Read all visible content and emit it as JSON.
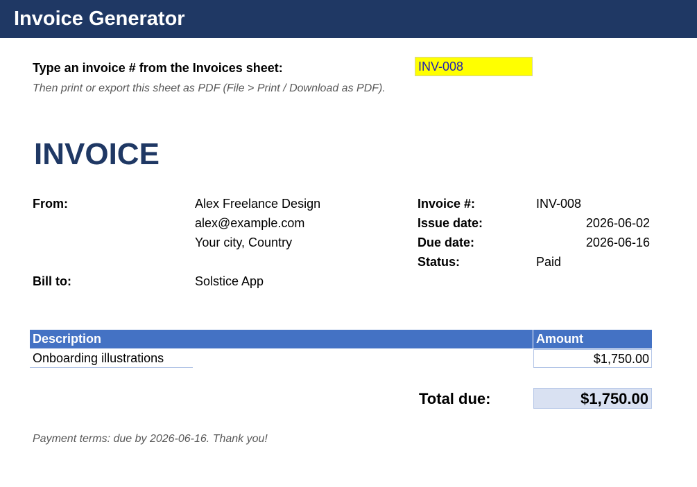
{
  "app": {
    "title": "Invoice Generator"
  },
  "colors": {
    "header_bg": "#1f3864",
    "input_highlight": "#ffff00",
    "table_header_bg": "#4472c4",
    "total_bg": "#d9e1f2"
  },
  "prompt": {
    "label": "Type an invoice # from the Invoices sheet:",
    "input_value": "INV-008",
    "hint": "Then print or export this sheet as PDF (File > Print / Download as PDF)."
  },
  "invoice": {
    "heading": "INVOICE",
    "from_label": "From:",
    "from_lines": [
      "Alex Freelance Design",
      "alex@example.com",
      "Your city, Country"
    ],
    "bill_to_label": "Bill to:",
    "bill_to": "Solstice App",
    "meta": {
      "number_label": "Invoice #:",
      "number": "INV-008",
      "issue_label": "Issue date:",
      "issue_date": "2026-06-02",
      "due_label": "Due date:",
      "due_date": "2026-06-16",
      "status_label": "Status:",
      "status": "Paid"
    }
  },
  "table": {
    "headers": [
      "Description",
      "Amount"
    ],
    "rows": [
      {
        "description": "Onboarding illustrations",
        "amount": "$1,750.00"
      }
    ]
  },
  "total": {
    "label": "Total due:",
    "value": "$1,750.00"
  },
  "footer": {
    "terms": "Payment terms: due by 2026-06-16. Thank you!"
  }
}
